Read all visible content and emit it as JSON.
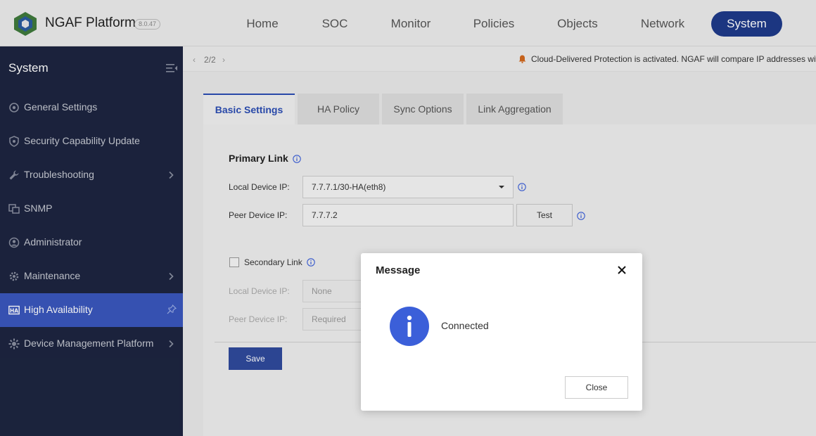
{
  "app": {
    "brand": "NGAF Platform",
    "version": "8.0.47"
  },
  "nav": {
    "items": [
      {
        "label": "Home"
      },
      {
        "label": "SOC"
      },
      {
        "label": "Monitor"
      },
      {
        "label": "Policies"
      },
      {
        "label": "Objects"
      },
      {
        "label": "Network"
      },
      {
        "label": "System",
        "active": true
      }
    ]
  },
  "sidebar": {
    "title": "System",
    "items": [
      {
        "label": "General Settings",
        "icon": "gear-icon"
      },
      {
        "label": "Security Capability Update",
        "icon": "shield-icon"
      },
      {
        "label": "Troubleshooting",
        "icon": "wrench-icon",
        "expandable": true
      },
      {
        "label": "SNMP",
        "icon": "snmp-icon"
      },
      {
        "label": "Administrator",
        "icon": "user-icon"
      },
      {
        "label": "Maintenance",
        "icon": "cog-icon",
        "expandable": true
      },
      {
        "label": "High Availability",
        "icon": "ha-icon",
        "active": true
      },
      {
        "label": "Device Management Platform",
        "icon": "platform-icon",
        "expandable": true
      }
    ]
  },
  "breadcrumb": {
    "prev": "‹",
    "page": "2/2",
    "next": "›"
  },
  "notice": {
    "text": "Cloud-Delivered Protection is activated. NGAF will compare IP addresses with"
  },
  "tabs": [
    {
      "label": "Basic Settings",
      "active": true
    },
    {
      "label": "HA Policy"
    },
    {
      "label": "Sync Options"
    },
    {
      "label": "Link Aggregation"
    }
  ],
  "form": {
    "primary_title": "Primary Link",
    "local_label": "Local Device IP:",
    "local_value": "7.7.7.1/30-HA(eth8)",
    "peer_label": "Peer Device IP:",
    "peer_value": "7.7.7.2",
    "test_label": "Test",
    "secondary_label": "Secondary Link",
    "secondary_checked": false,
    "sec_local_label": "Local Device IP:",
    "sec_local_value": "None",
    "sec_peer_label": "Peer Device IP:",
    "sec_peer_value": "Required",
    "save_label": "Save"
  },
  "modal": {
    "title": "Message",
    "message": "Connected",
    "close_label": "Close"
  },
  "colors": {
    "sidebar_bg": "#1d2540",
    "active_nav": "#1e3a8a",
    "active_side": "#3a57bd",
    "info_blue": "#3b5fd9",
    "save_btn": "#2f4a9c"
  }
}
